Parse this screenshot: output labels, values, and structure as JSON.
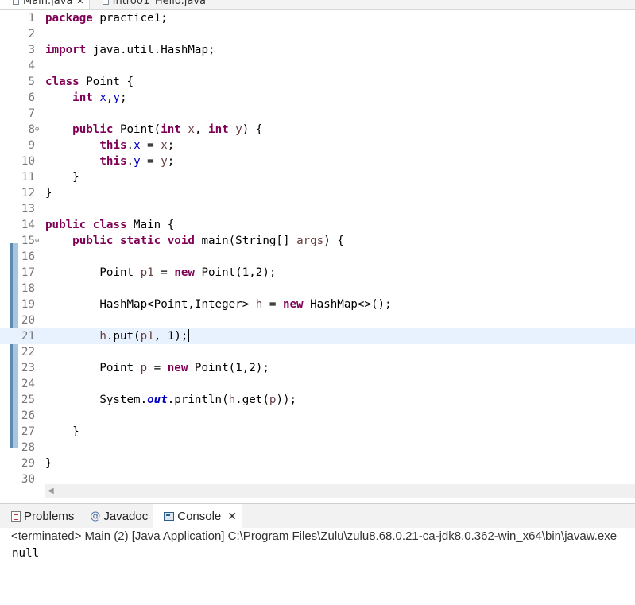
{
  "editor_tabs": [
    {
      "label": "Main.java",
      "active": true
    },
    {
      "label": "Intro01_Hello.java",
      "active": false
    }
  ],
  "code": {
    "lines": [
      {
        "n": "1",
        "tokens": [
          {
            "t": "kw",
            "v": "package"
          },
          {
            "t": "p",
            "v": " practice1;"
          }
        ]
      },
      {
        "n": "2",
        "tokens": []
      },
      {
        "n": "3",
        "tokens": [
          {
            "t": "kw",
            "v": "import"
          },
          {
            "t": "p",
            "v": " java.util.HashMap;"
          }
        ]
      },
      {
        "n": "4",
        "tokens": []
      },
      {
        "n": "5",
        "tokens": [
          {
            "t": "kw",
            "v": "class"
          },
          {
            "t": "p",
            "v": " Point {"
          }
        ]
      },
      {
        "n": "6",
        "tokens": [
          {
            "t": "p",
            "v": "    "
          },
          {
            "t": "kw",
            "v": "int"
          },
          {
            "t": "p",
            "v": " "
          },
          {
            "t": "fld",
            "v": "x"
          },
          {
            "t": "p",
            "v": ","
          },
          {
            "t": "fld",
            "v": "y"
          },
          {
            "t": "p",
            "v": ";"
          }
        ]
      },
      {
        "n": "7",
        "tokens": []
      },
      {
        "n": "8",
        "fold": true,
        "tokens": [
          {
            "t": "p",
            "v": "    "
          },
          {
            "t": "kw",
            "v": "public"
          },
          {
            "t": "p",
            "v": " Point("
          },
          {
            "t": "kw",
            "v": "int"
          },
          {
            "t": "p",
            "v": " "
          },
          {
            "t": "par",
            "v": "x"
          },
          {
            "t": "p",
            "v": ", "
          },
          {
            "t": "kw",
            "v": "int"
          },
          {
            "t": "p",
            "v": " "
          },
          {
            "t": "par",
            "v": "y"
          },
          {
            "t": "p",
            "v": ") {"
          }
        ]
      },
      {
        "n": "9",
        "tokens": [
          {
            "t": "p",
            "v": "        "
          },
          {
            "t": "kw",
            "v": "this"
          },
          {
            "t": "p",
            "v": "."
          },
          {
            "t": "fld",
            "v": "x"
          },
          {
            "t": "p",
            "v": " = "
          },
          {
            "t": "par",
            "v": "x"
          },
          {
            "t": "p",
            "v": ";"
          }
        ]
      },
      {
        "n": "10",
        "tokens": [
          {
            "t": "p",
            "v": "        "
          },
          {
            "t": "kw",
            "v": "this"
          },
          {
            "t": "p",
            "v": "."
          },
          {
            "t": "fld",
            "v": "y"
          },
          {
            "t": "p",
            "v": " = "
          },
          {
            "t": "par",
            "v": "y"
          },
          {
            "t": "p",
            "v": ";"
          }
        ]
      },
      {
        "n": "11",
        "tokens": [
          {
            "t": "p",
            "v": "    }"
          }
        ]
      },
      {
        "n": "12",
        "tokens": [
          {
            "t": "p",
            "v": "}"
          }
        ]
      },
      {
        "n": "13",
        "tokens": []
      },
      {
        "n": "14",
        "tokens": [
          {
            "t": "kw",
            "v": "public"
          },
          {
            "t": "p",
            "v": " "
          },
          {
            "t": "kw",
            "v": "class"
          },
          {
            "t": "p",
            "v": " Main {"
          }
        ]
      },
      {
        "n": "15",
        "fold": true,
        "tokens": [
          {
            "t": "p",
            "v": "    "
          },
          {
            "t": "kw",
            "v": "public"
          },
          {
            "t": "p",
            "v": " "
          },
          {
            "t": "kw",
            "v": "static"
          },
          {
            "t": "p",
            "v": " "
          },
          {
            "t": "kw",
            "v": "void"
          },
          {
            "t": "p",
            "v": " main(String[] "
          },
          {
            "t": "par",
            "v": "args"
          },
          {
            "t": "p",
            "v": ") {"
          }
        ]
      },
      {
        "n": "16",
        "tokens": []
      },
      {
        "n": "17",
        "tokens": [
          {
            "t": "p",
            "v": "        Point "
          },
          {
            "t": "par",
            "v": "p1"
          },
          {
            "t": "p",
            "v": " = "
          },
          {
            "t": "kw",
            "v": "new"
          },
          {
            "t": "p",
            "v": " Point(1,2);"
          }
        ]
      },
      {
        "n": "18",
        "tokens": []
      },
      {
        "n": "19",
        "tokens": [
          {
            "t": "p",
            "v": "        HashMap<Point,Integer> "
          },
          {
            "t": "par",
            "v": "h"
          },
          {
            "t": "p",
            "v": " = "
          },
          {
            "t": "kw",
            "v": "new"
          },
          {
            "t": "p",
            "v": " HashMap<>();"
          }
        ]
      },
      {
        "n": "20",
        "tokens": []
      },
      {
        "n": "21",
        "current": true,
        "tokens": [
          {
            "t": "p",
            "v": "        "
          },
          {
            "t": "par",
            "v": "h"
          },
          {
            "t": "p",
            "v": ".put("
          },
          {
            "t": "par",
            "v": "p1"
          },
          {
            "t": "p",
            "v": ", 1);"
          }
        ]
      },
      {
        "n": "22",
        "tokens": []
      },
      {
        "n": "23",
        "tokens": [
          {
            "t": "p",
            "v": "        Point "
          },
          {
            "t": "par",
            "v": "p"
          },
          {
            "t": "p",
            "v": " = "
          },
          {
            "t": "kw",
            "v": "new"
          },
          {
            "t": "p",
            "v": " Point(1,2);"
          }
        ]
      },
      {
        "n": "24",
        "tokens": []
      },
      {
        "n": "25",
        "tokens": [
          {
            "t": "p",
            "v": "        System."
          },
          {
            "t": "sfld",
            "v": "out"
          },
          {
            "t": "p",
            "v": ".println("
          },
          {
            "t": "par",
            "v": "h"
          },
          {
            "t": "p",
            "v": ".get("
          },
          {
            "t": "par",
            "v": "p"
          },
          {
            "t": "p",
            "v": "));"
          }
        ]
      },
      {
        "n": "26",
        "tokens": []
      },
      {
        "n": "27",
        "tokens": [
          {
            "t": "p",
            "v": "    }"
          }
        ]
      },
      {
        "n": "28",
        "tokens": []
      },
      {
        "n": "29",
        "tokens": [
          {
            "t": "p",
            "v": "}"
          }
        ]
      },
      {
        "n": "30",
        "tokens": []
      }
    ]
  },
  "views": {
    "tabs": [
      {
        "label": "Problems",
        "icon": "problems-icon",
        "active": false
      },
      {
        "label": "Javadoc",
        "icon": "javadoc-icon",
        "active": false
      },
      {
        "label": "Console",
        "icon": "console-icon",
        "active": true
      }
    ],
    "console_status": "<terminated> Main (2) [Java Application] C:\\Program Files\\Zulu\\zulu8.68.0.21-ca-jdk8.0.362-win_x64\\bin\\javaw.exe",
    "console_output": "null"
  },
  "colors": {
    "keyword": "#7f0055",
    "field": "#0000c0",
    "parameter": "#6a3e3e",
    "current_line": "#e8f2fe",
    "change_ruler": "#a7c5de"
  }
}
